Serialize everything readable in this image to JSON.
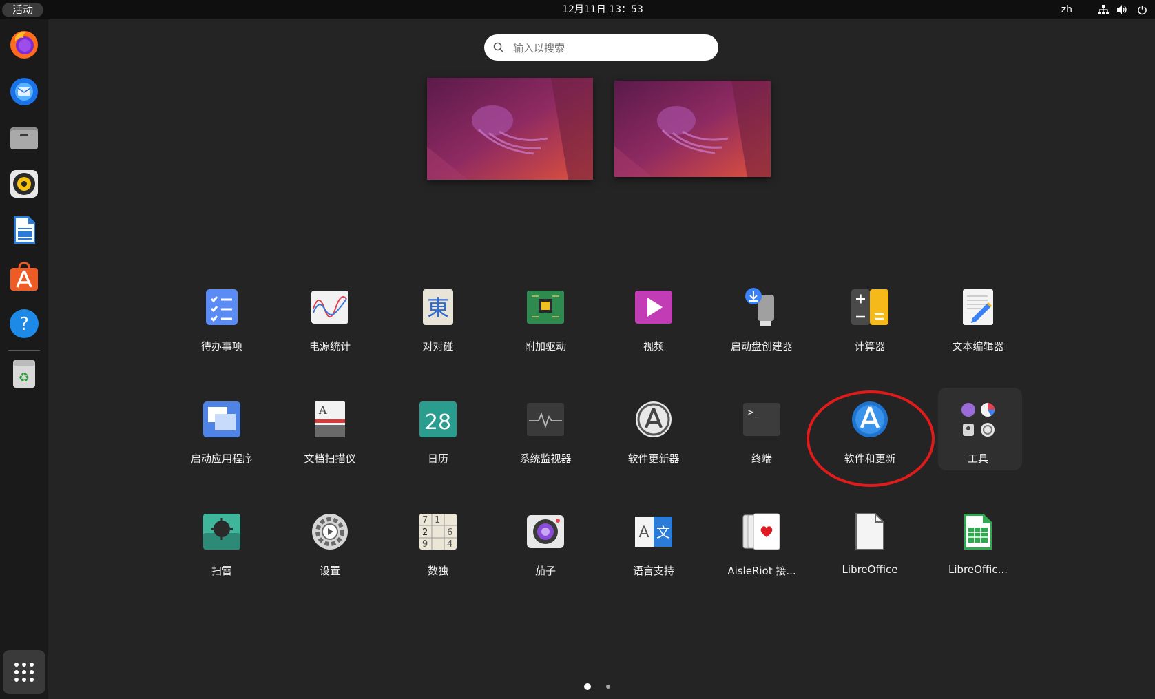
{
  "topbar": {
    "activities": "活动",
    "clock": "12月11日  13：53",
    "language": "zh",
    "tray_icons": [
      "network-icon",
      "volume-icon",
      "power-icon"
    ]
  },
  "dock": {
    "apps": [
      "firefox",
      "thunderbird",
      "files",
      "rhythmbox",
      "libreoffice-writer",
      "ubuntu-software",
      "help"
    ],
    "trash": "trash",
    "show_apps": "show-applications"
  },
  "search": {
    "placeholder": "输入以搜索",
    "value": ""
  },
  "app_grid": {
    "rows": [
      [
        {
          "label": "待办事项",
          "icon": "todo-icon"
        },
        {
          "label": "电源统计",
          "icon": "power-statistics-icon"
        },
        {
          "label": "对对碰",
          "icon": "mahjongg-icon"
        },
        {
          "label": "附加驱动",
          "icon": "additional-drivers-icon"
        },
        {
          "label": "视频",
          "icon": "videos-icon"
        },
        {
          "label": "启动盘创建器",
          "icon": "startup-disk-creator-icon"
        },
        {
          "label": "计算器",
          "icon": "calculator-icon"
        },
        {
          "label": "文本编辑器",
          "icon": "text-editor-icon"
        }
      ],
      [
        {
          "label": "启动应用程序",
          "icon": "startup-applications-icon"
        },
        {
          "label": "文档扫描仪",
          "icon": "document-scanner-icon"
        },
        {
          "label": "日历",
          "icon": "calendar-icon",
          "icon_text": "28"
        },
        {
          "label": "系统监视器",
          "icon": "system-monitor-icon"
        },
        {
          "label": "软件更新器",
          "icon": "software-updater-icon"
        },
        {
          "label": "终端",
          "icon": "terminal-icon"
        },
        {
          "label": "软件和更新",
          "icon": "software-properties-icon"
        },
        {
          "label": "工具",
          "icon": "utilities-folder-icon"
        }
      ],
      [
        {
          "label": "扫雷",
          "icon": "mines-icon"
        },
        {
          "label": "设置",
          "icon": "settings-icon"
        },
        {
          "label": "数独",
          "icon": "sudoku-icon"
        },
        {
          "label": "茄子",
          "icon": "cheese-icon"
        },
        {
          "label": "语言支持",
          "icon": "language-support-icon"
        },
        {
          "label": "AisleRiot 接...",
          "icon": "aisleriot-icon"
        },
        {
          "label": "LibreOffice",
          "icon": "libreoffice-icon"
        },
        {
          "label": "LibreOffic...",
          "icon": "libreoffice-calc-icon"
        }
      ]
    ]
  },
  "pages": {
    "count": 2,
    "current": 1
  },
  "colors": {
    "accent_ring": "#e01b1b",
    "background": "#242424"
  }
}
